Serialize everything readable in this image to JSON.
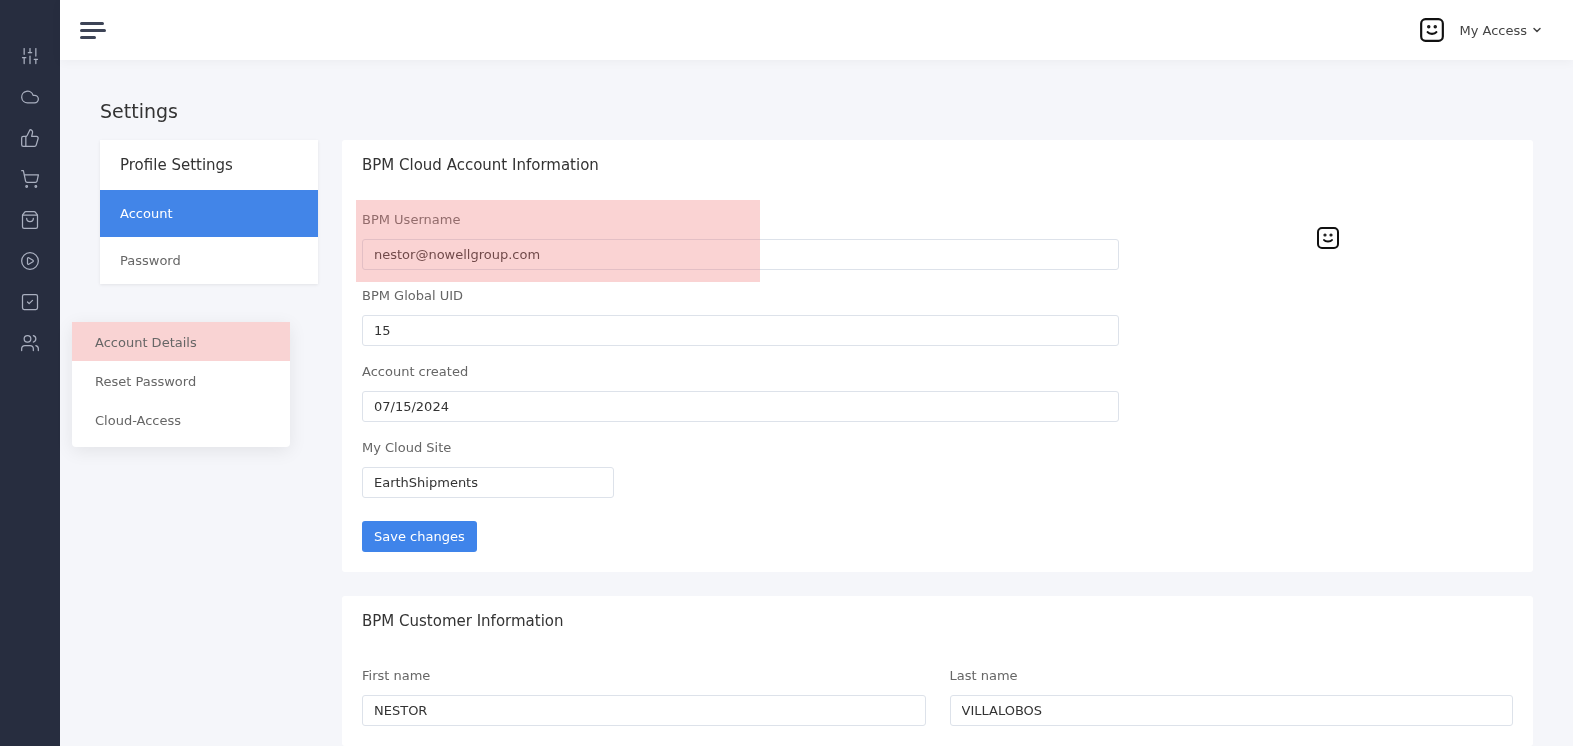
{
  "topbar": {
    "user_menu": "My Access"
  },
  "page_title": "Settings",
  "profile_nav": {
    "title": "Profile Settings",
    "items": [
      {
        "label": "Account",
        "selected": true
      },
      {
        "label": "Password",
        "selected": false
      }
    ]
  },
  "popup_menu": {
    "items": [
      {
        "label": "Account Details",
        "highlighted": true
      },
      {
        "label": "Reset Password",
        "highlighted": false
      },
      {
        "label": "Cloud-Access",
        "highlighted": false
      }
    ]
  },
  "account_card": {
    "title": "BPM Cloud Account Information",
    "fields": [
      {
        "label": "BPM Username",
        "value": "nestor@nowellgroup.com",
        "highlighted": true,
        "kind": "full"
      },
      {
        "label": "BPM Global UID",
        "value": "15",
        "highlighted": false,
        "kind": "full"
      },
      {
        "label": "Account created",
        "value": "07/15/2024",
        "highlighted": false,
        "kind": "full"
      },
      {
        "label": "My Cloud Site",
        "value": "EarthShipments",
        "highlighted": false,
        "kind": "short"
      }
    ],
    "save_button": "Save changes"
  },
  "customer_card": {
    "title": "BPM Customer Information",
    "fields": [
      {
        "label": "First name",
        "value": "NESTOR"
      },
      {
        "label": "Last name",
        "value": "VILLALOBOS"
      }
    ]
  }
}
